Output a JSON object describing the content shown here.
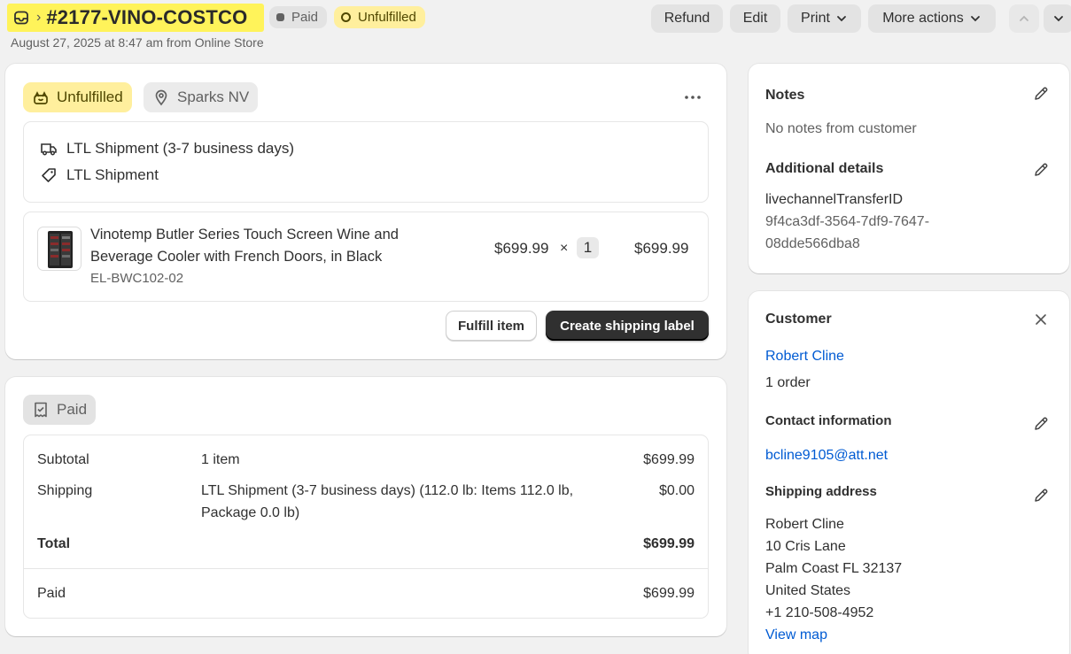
{
  "header": {
    "order_number": "#2177-VINO-COSTCO",
    "payment_badge": "Paid",
    "fulfillment_badge": "Unfulfilled",
    "subtitle": "August 27, 2025 at 8:47 am from Online Store",
    "buttons": {
      "refund": "Refund",
      "edit": "Edit",
      "print": "Print",
      "more_actions": "More actions"
    }
  },
  "fulfillment_card": {
    "status": "Unfulfilled",
    "location": "Sparks NV",
    "shipping_method": "LTL Shipment (3-7 business days)",
    "shipping_tag": "LTL Shipment",
    "item": {
      "title_line1": "Vinotemp Butler Series Touch Screen Wine and",
      "title_line2": "Beverage Cooler with French Doors, in Black",
      "sku": "EL-BWC102-02",
      "unit_price": "$699.99",
      "times": "×",
      "quantity": "1",
      "line_total": "$699.99"
    },
    "fulfill_button": "Fulfill item",
    "label_button": "Create shipping label"
  },
  "payment_card": {
    "status": "Paid",
    "rows": {
      "subtotal_label": "Subtotal",
      "subtotal_desc": "1 item",
      "subtotal_value": "$699.99",
      "shipping_label": "Shipping",
      "shipping_desc_line1": "LTL Shipment (3-7 business days) (112.0 lb: Items 112.0 lb,",
      "shipping_desc_line2": "Package 0.0 lb)",
      "shipping_value": "$0.00",
      "total_label": "Total",
      "total_value": "$699.99",
      "paid_label": "Paid",
      "paid_value": "$699.99"
    }
  },
  "notes_card": {
    "notes_title": "Notes",
    "notes_text": "No notes from customer",
    "details_title": "Additional details",
    "details_key": "livechannelTransferID",
    "details_value_line1": "9f4ca3df-3564-7df9-7647-",
    "details_value_line2": "08dde566dba8"
  },
  "customer_card": {
    "title": "Customer",
    "name": "Robert Cline",
    "orders": "1 order",
    "contact_title": "Contact information",
    "email": "bcline9105@att.net",
    "shipping_title": "Shipping address",
    "address": {
      "name": "Robert Cline",
      "street": "10 Cris Lane",
      "city": "Palm Coast FL 32137",
      "country": "United States",
      "phone": "+1 210-508-4952"
    },
    "view_map": "View map"
  },
  "colors": {
    "highlight": "#fff35a",
    "unfulfilled_badge": "#ffef9d",
    "link": "#005bd3",
    "primary_button": "#303030"
  },
  "icons": [
    "inbox-icon",
    "chevron-right-icon",
    "chevron-down-icon",
    "chevron-up-icon",
    "fulfillment-icon",
    "location-pin-icon",
    "more-horizontal-icon",
    "truck-icon",
    "tag-icon",
    "receipt-icon",
    "edit-icon",
    "close-icon"
  ]
}
